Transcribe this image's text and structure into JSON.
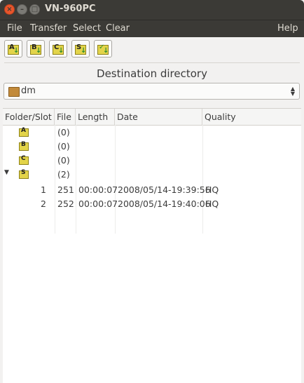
{
  "window": {
    "title": "VN-960PC"
  },
  "menubar": {
    "file": "File",
    "transfer": "Transfer",
    "select": "Select",
    "clear": "Clear",
    "help": "Help"
  },
  "toolbar": {
    "buttons": [
      {
        "letter": "A",
        "icon": "folder-a-download-icon"
      },
      {
        "letter": "B",
        "icon": "folder-b-download-icon"
      },
      {
        "letter": "C",
        "icon": "folder-c-download-icon"
      },
      {
        "letter": "S",
        "icon": "folder-s-download-icon"
      },
      {
        "letter": "",
        "icon": "folder-check-download-icon"
      }
    ]
  },
  "destination": {
    "label": "Destination directory",
    "value": "dm"
  },
  "table": {
    "columns": [
      "Folder/Slot",
      "File",
      "Length",
      "Date",
      "Quality"
    ],
    "folders": [
      {
        "letter": "A",
        "count": "(0)"
      },
      {
        "letter": "B",
        "count": "(0)"
      },
      {
        "letter": "C",
        "count": "(0)"
      },
      {
        "letter": "S",
        "count": "(2)",
        "expanded": true
      }
    ],
    "rows": [
      {
        "slot": "1",
        "file": "251",
        "length": "00:00:07",
        "date": "2008/05/14-19:39:56",
        "quality": "HQ"
      },
      {
        "slot": "2",
        "file": "252",
        "length": "00:00:07",
        "date": "2008/05/14-19:40:06",
        "quality": "HQ"
      }
    ]
  },
  "colors": {
    "titlebar": "#3b3a36",
    "close_button": "#e8552b",
    "folder_icon": "#e3d44a",
    "background": "#f2f1f0"
  }
}
